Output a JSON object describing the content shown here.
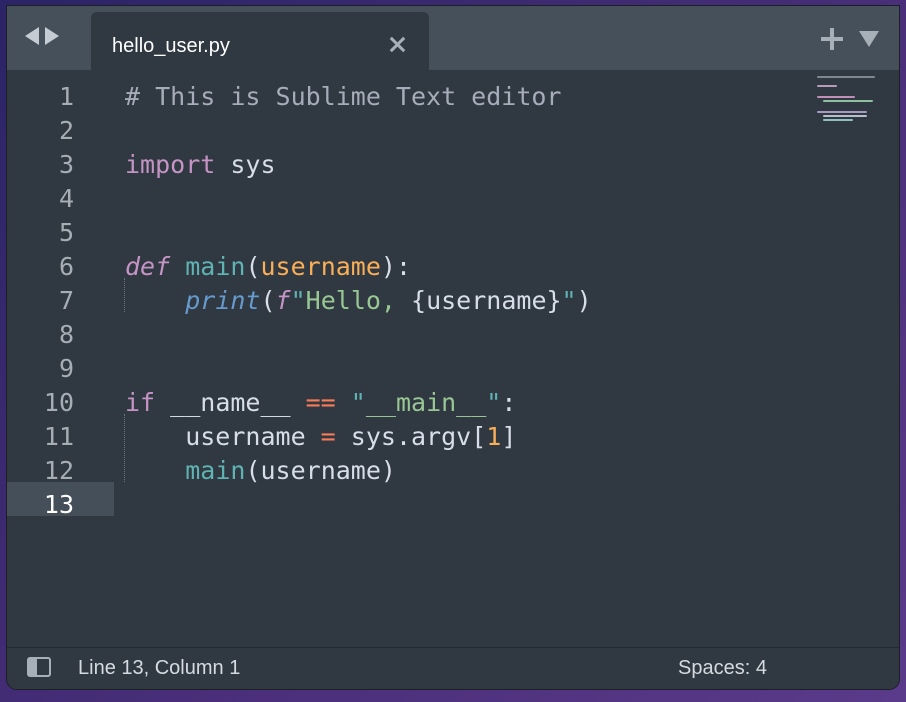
{
  "tab": {
    "title": "hello_user.py"
  },
  "icons": {
    "back": "chevron-left-icon",
    "forward": "chevron-right-icon",
    "close": "close-icon",
    "new_tab": "plus-icon",
    "tab_menu": "triangle-down-icon",
    "sidebar": "sidebar-toggle-icon"
  },
  "editor": {
    "current_line": 13,
    "line_numbers": [
      "1",
      "2",
      "3",
      "4",
      "5",
      "6",
      "7",
      "8",
      "9",
      "10",
      "11",
      "12",
      "13"
    ],
    "lines": [
      [
        {
          "t": "# This is Sublime Text editor",
          "c": "comment"
        }
      ],
      [],
      [
        {
          "t": "import",
          "c": "kw"
        },
        {
          "t": " sys",
          "c": "plain"
        }
      ],
      [],
      [],
      [
        {
          "t": "def",
          "c": "def"
        },
        {
          "t": " ",
          "c": "plain"
        },
        {
          "t": "main",
          "c": "fn"
        },
        {
          "t": "(",
          "c": "plain"
        },
        {
          "t": "username",
          "c": "param"
        },
        {
          "t": "):",
          "c": "plain"
        }
      ],
      [
        {
          "t": "    ",
          "c": "plain"
        },
        {
          "t": "print",
          "c": "builtin"
        },
        {
          "t": "(",
          "c": "plain"
        },
        {
          "t": "f",
          "c": "fprefix"
        },
        {
          "t": "\"",
          "c": "strq"
        },
        {
          "t": "Hello, ",
          "c": "str"
        },
        {
          "t": "{username}",
          "c": "plain"
        },
        {
          "t": "\"",
          "c": "strq"
        },
        {
          "t": ")",
          "c": "plain"
        }
      ],
      [],
      [],
      [
        {
          "t": "if",
          "c": "kw"
        },
        {
          "t": " __name__ ",
          "c": "plain"
        },
        {
          "t": "==",
          "c": "op"
        },
        {
          "t": " ",
          "c": "plain"
        },
        {
          "t": "\"",
          "c": "strq"
        },
        {
          "t": "__main__",
          "c": "str"
        },
        {
          "t": "\"",
          "c": "strq"
        },
        {
          "t": ":",
          "c": "plain"
        }
      ],
      [
        {
          "t": "    username ",
          "c": "plain"
        },
        {
          "t": "=",
          "c": "op"
        },
        {
          "t": " sys.argv[",
          "c": "plain"
        },
        {
          "t": "1",
          "c": "num"
        },
        {
          "t": "]",
          "c": "plain"
        }
      ],
      [
        {
          "t": "    ",
          "c": "plain"
        },
        {
          "t": "main",
          "c": "fn"
        },
        {
          "t": "(username)",
          "c": "plain"
        }
      ],
      []
    ]
  },
  "colors": {
    "background": "#303841",
    "tabbar": "#46505a",
    "comment": "#a6acb9",
    "keyword": "#c594c5",
    "function": "#5fb3b3",
    "parameter": "#f9ae58",
    "string": "#99c794",
    "operator": "#f97b58"
  },
  "status": {
    "position": "Line 13, Column 1",
    "indent": "Spaces: 4"
  }
}
